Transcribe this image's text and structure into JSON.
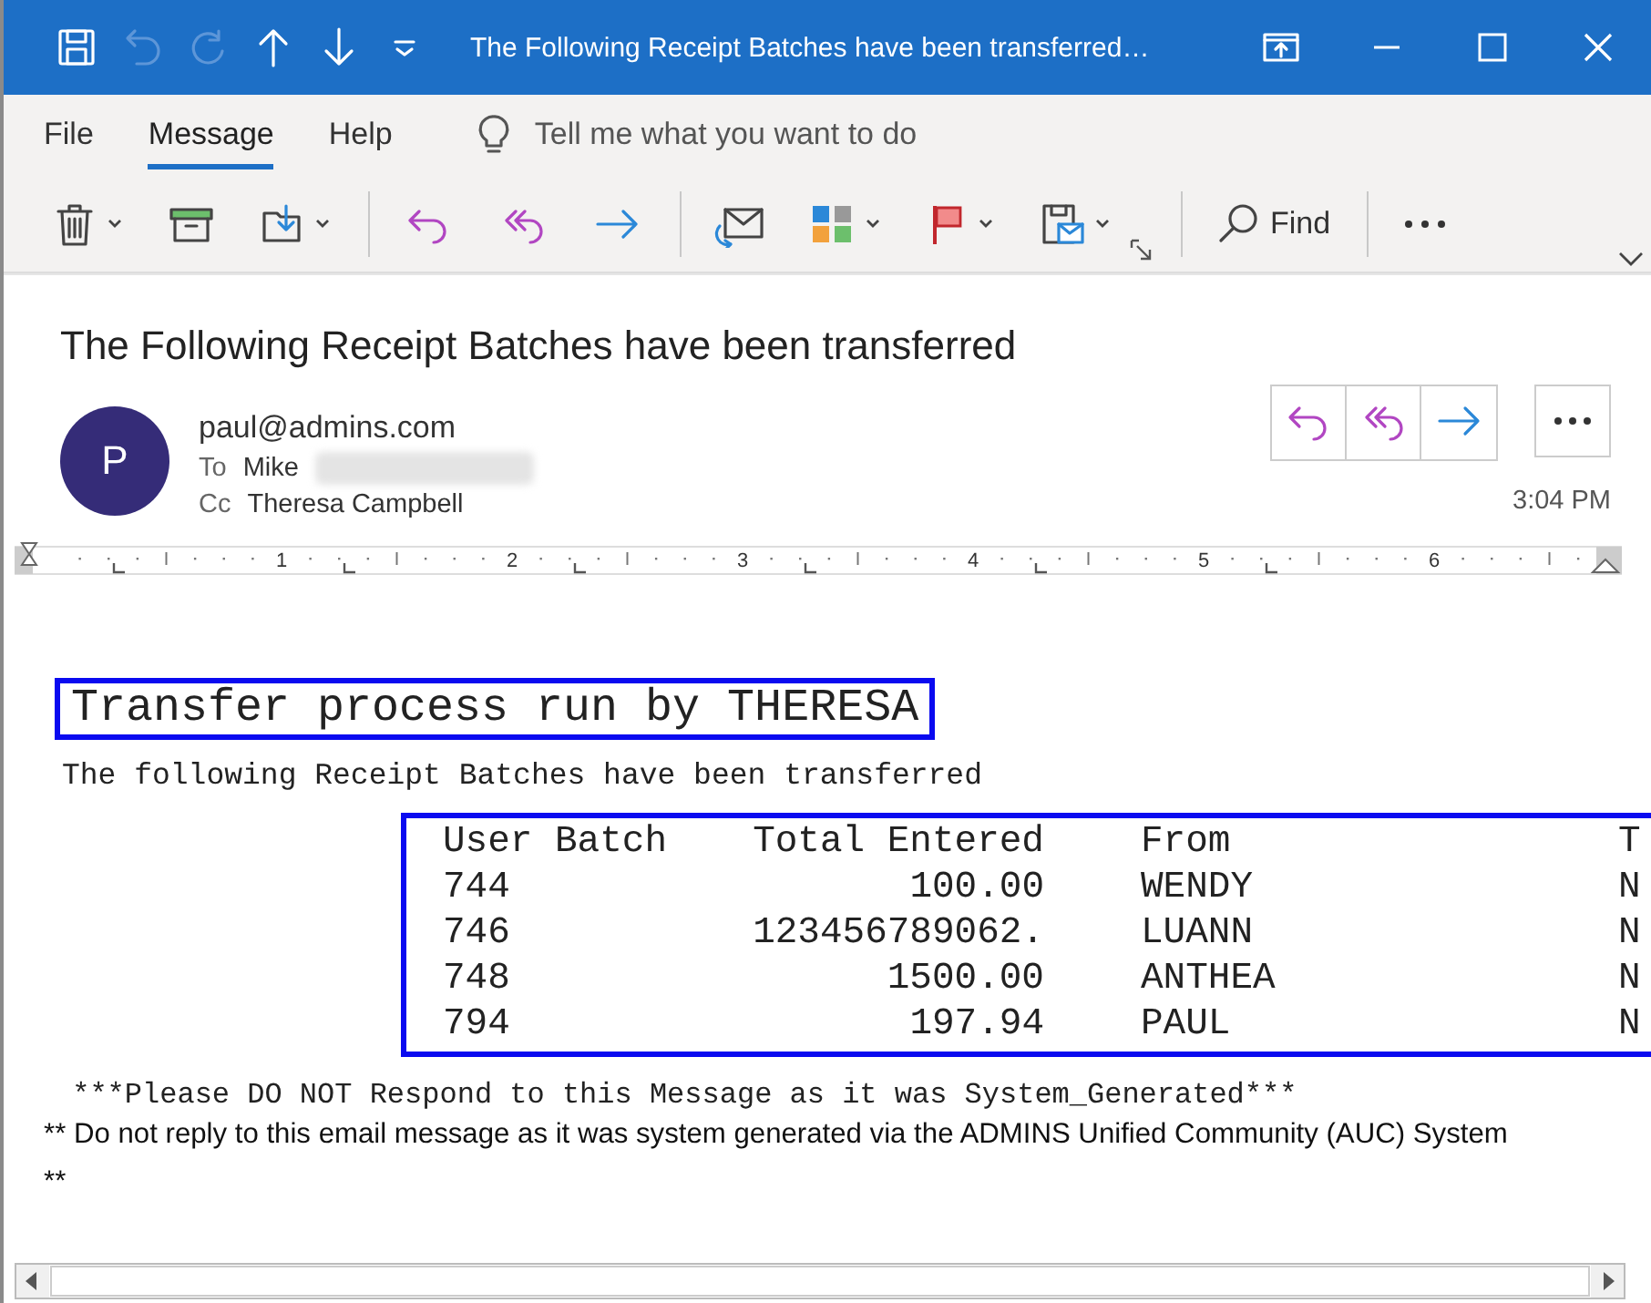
{
  "window": {
    "title": "The Following Receipt Batches have been transferred…"
  },
  "quick_access": [
    {
      "kind": "save",
      "disabled": false
    },
    {
      "kind": "undo",
      "disabled": true
    },
    {
      "kind": "redo",
      "disabled": true
    },
    {
      "kind": "up",
      "disabled": false
    },
    {
      "kind": "down",
      "disabled": false
    },
    {
      "kind": "customize",
      "disabled": false
    }
  ],
  "ribbon_tabs": [
    {
      "label": "File",
      "selected": false
    },
    {
      "label": "Message",
      "selected": true
    },
    {
      "label": "Help",
      "selected": false
    }
  ],
  "tell_me": {
    "placeholder": "Tell me what you want to do"
  },
  "toolbar": [
    {
      "kind": "delete",
      "dropdown": true
    },
    {
      "kind": "archive"
    },
    {
      "kind": "move",
      "dropdown": true
    },
    {
      "kind": "separator"
    },
    {
      "kind": "reply"
    },
    {
      "kind": "reply_all"
    },
    {
      "kind": "forward"
    },
    {
      "kind": "separator"
    },
    {
      "kind": "unread"
    },
    {
      "kind": "categorize",
      "dropdown": true
    },
    {
      "kind": "flag",
      "dropdown": true
    },
    {
      "kind": "policy",
      "dropdown": true
    },
    {
      "kind": "launcher"
    },
    {
      "kind": "separator"
    },
    {
      "kind": "find",
      "label": "Find"
    },
    {
      "kind": "separator"
    },
    {
      "kind": "more"
    }
  ],
  "message": {
    "subject": "The Following Receipt Batches have been transferred",
    "initial": "P",
    "sender": "paul@admins.com",
    "to_label": "To",
    "to": "Mike",
    "to_redacted": true,
    "cc_label": "Cc",
    "cc": "Theresa Campbell",
    "time": "3:04 PM",
    "actions": [
      {
        "kind": "reply"
      },
      {
        "kind": "reply_all"
      },
      {
        "kind": "forward"
      }
    ]
  },
  "ruler": {
    "labels": [
      "1",
      "2",
      "3",
      "4",
      "5",
      "6"
    ]
  },
  "body": {
    "heading": "Transfer process run by THERESA",
    "intro": "The following Receipt Batches have been transferred",
    "table": {
      "columns": [
        "User Batch",
        "Total Entered",
        "From",
        "T"
      ],
      "rows": [
        [
          "744",
          "100.00",
          "WENDY",
          "N"
        ],
        [
          "746",
          "123456789062.",
          "LUANN",
          "N"
        ],
        [
          "748",
          "1500.00",
          "ANTHEA",
          "N"
        ],
        [
          "794",
          "197.94",
          "PAUL",
          "N"
        ]
      ]
    },
    "notice": " ***Please DO NOT Respond to this Message as it was System_Generated***",
    "footer": "** Do not reply to this email message as it was system generated via the ADMINS Unified Community (AUC) System **"
  }
}
